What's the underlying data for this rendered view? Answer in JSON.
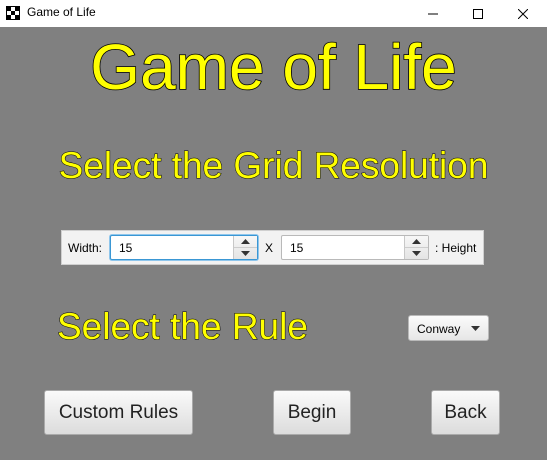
{
  "window": {
    "title": "Game of Life",
    "controls": [
      "minimize",
      "maximize",
      "close"
    ]
  },
  "main": {
    "title": "Game of Life",
    "grid_heading": "Select the Grid Resolution",
    "rule_heading": "Select the Rule"
  },
  "resolution": {
    "width_label": "Width:",
    "width_value": "15",
    "separator": "X",
    "height_value": "15",
    "height_label": ": Height"
  },
  "rule_select": {
    "selected": "Conway"
  },
  "buttons": {
    "custom_rules": "Custom Rules",
    "begin": "Begin",
    "back": "Back"
  },
  "colors": {
    "background": "#808080",
    "heading_fill": "#ffff00",
    "heading_outline": "#000000",
    "focus_accent": "#3a97d4"
  },
  "icons": {
    "app": "game-of-life-grid-icon",
    "minimize": "minimize-icon",
    "maximize": "maximize-icon",
    "close": "close-icon",
    "spin_up": "chevron-up-icon",
    "spin_down": "chevron-down-icon",
    "dropdown": "chevron-down-icon"
  }
}
